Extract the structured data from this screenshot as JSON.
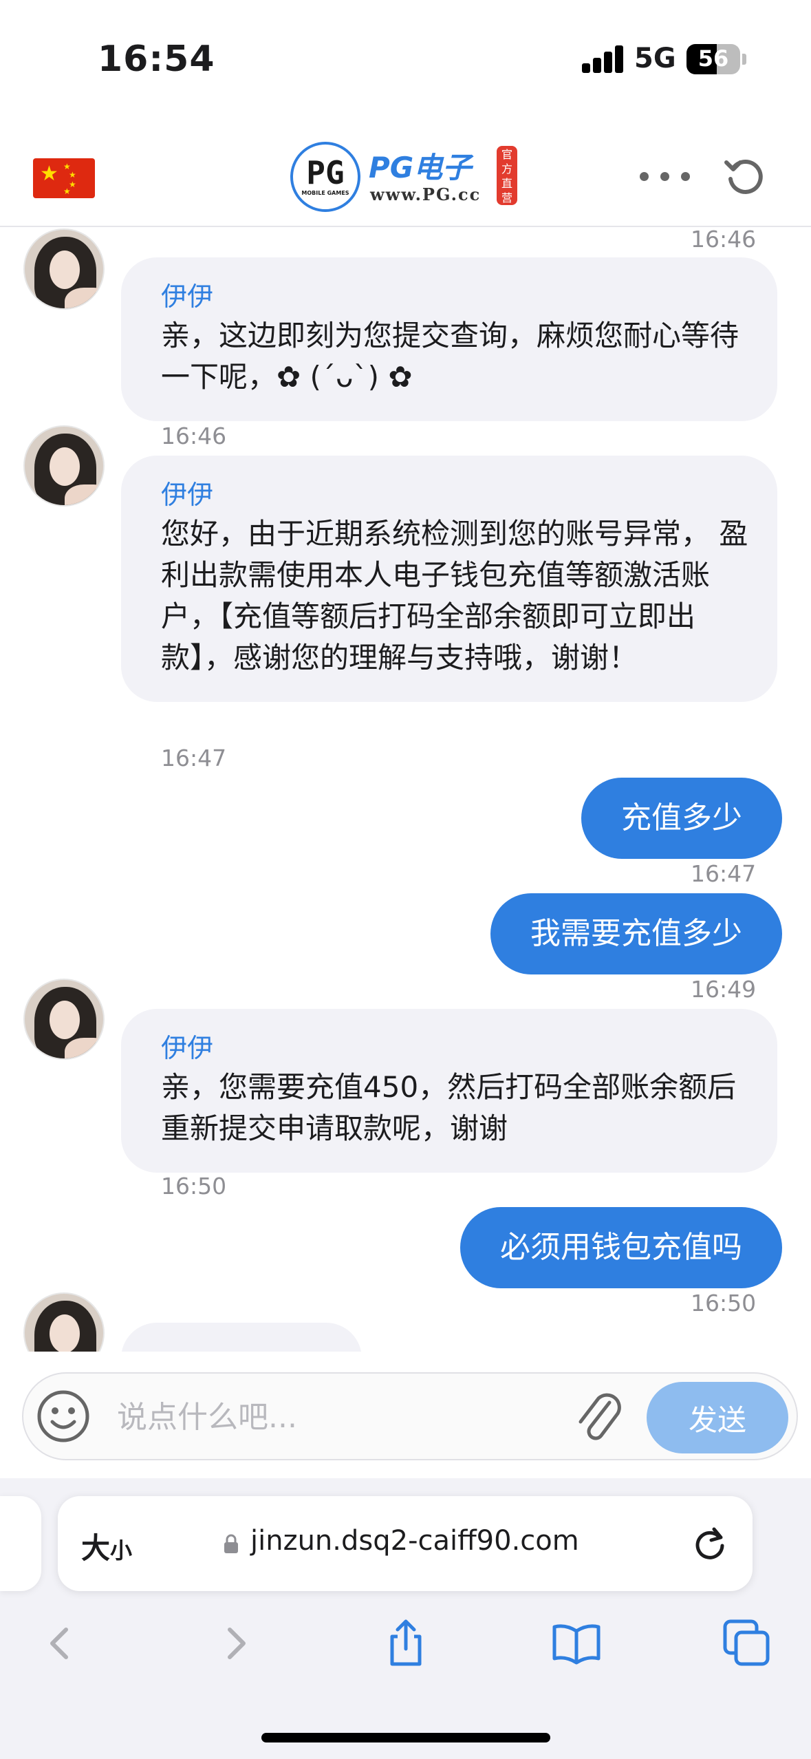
{
  "status_bar": {
    "time": "16:54",
    "network": "5G",
    "battery": "56"
  },
  "header": {
    "flag_icon": "china-flag-icon",
    "logo": {
      "circle_text": "PG",
      "circle_subtext": "MOBILE GAMES",
      "brand": "PG电子",
      "url": "www.PG.cc",
      "seal": "官方直营"
    },
    "more_icon": "ellipsis-icon",
    "refresh_icon": "refresh-icon"
  },
  "messages": [
    {
      "direction": "in",
      "time_before": "16:46",
      "sender": "伊伊",
      "text": "亲，这边即刻为您提交查询，麻烦您耐心等待一下呢，✿ (ˊᴗˋ) ✿"
    },
    {
      "direction": "in",
      "time_before": "16:46",
      "sender": "伊伊",
      "text": "您好，由于近期系统检测到您的账号异常， 盈利出款需使用本人电子钱包充值等额激活账户，【充值等额后打码全部余额即可立即出款】，感谢您的理解与支持哦，谢谢！"
    },
    {
      "direction": "out",
      "time_before": "16:47",
      "text": "充值多少",
      "time_after": "16:47"
    },
    {
      "direction": "out",
      "text": "我需要充值多少",
      "time_after": "16:49"
    },
    {
      "direction": "in",
      "sender": "伊伊",
      "text": "亲，您需要充值450，然后打码全部账余额后重新提交申请取款呢，谢谢",
      "time_after": "16:50"
    },
    {
      "direction": "out",
      "text": "必须用钱包充值吗",
      "time_after": "16:50"
    }
  ],
  "input_bar": {
    "placeholder": "说点什么吧...",
    "send_label": "发送",
    "emoji_icon": "smiley-icon",
    "attach_icon": "paperclip-icon"
  },
  "browser": {
    "text_size_label": "大",
    "text_size_small": "小",
    "url": "jinzun.dsq2-caiff90.com",
    "nav_icons": [
      "back-icon",
      "forward-icon",
      "share-icon",
      "bookmarks-icon",
      "tabs-icon"
    ]
  },
  "colors": {
    "accent": "#2f7fe0",
    "incoming_bubble": "#f2f2f7",
    "send_disabled": "#8ebcef"
  }
}
